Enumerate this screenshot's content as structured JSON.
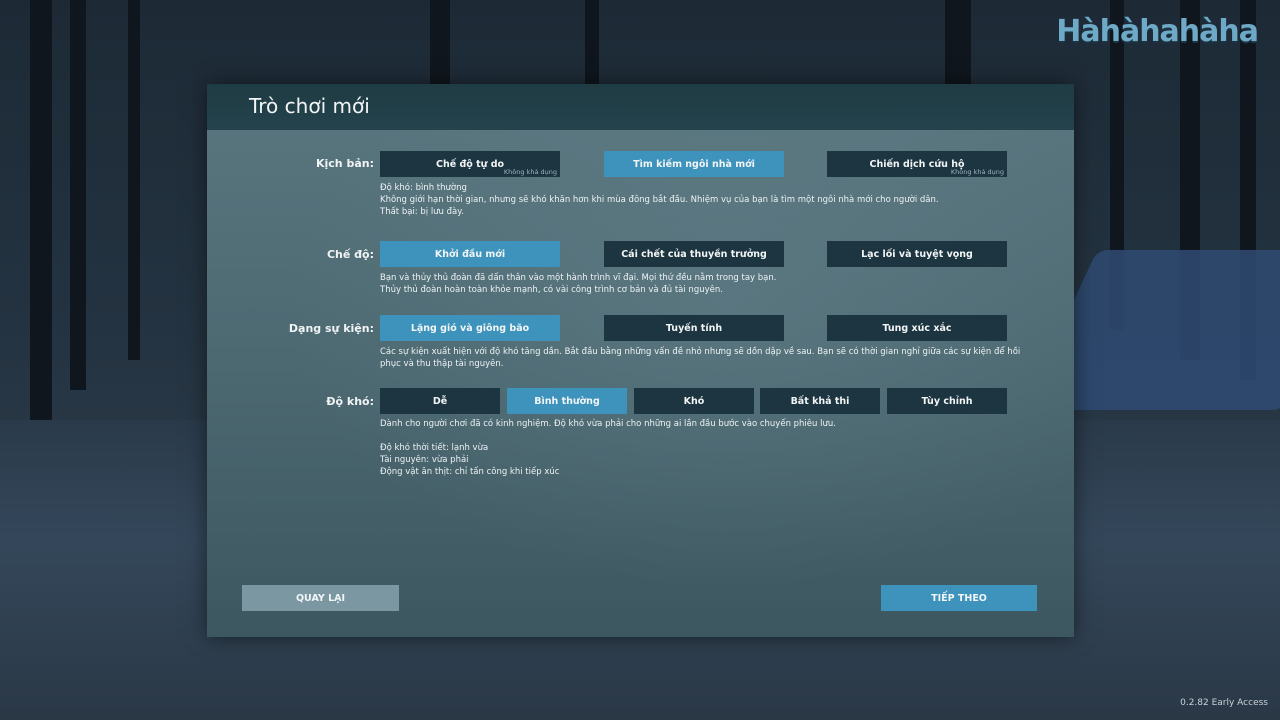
{
  "brand": {
    "logo": "Hàhàhahàha"
  },
  "version": "0.2.82 Early Access",
  "title": "Trò chơi mới",
  "sections": {
    "scenario": {
      "label": "Kịch bản:",
      "options": [
        {
          "label": "Chế độ tự do",
          "note": "Không khả dụng"
        },
        {
          "label": "Tìm kiếm ngôi nhà mới"
        },
        {
          "label": "Chiến dịch cứu hộ",
          "note": "Không khả dụng"
        }
      ],
      "desc": [
        "Độ khó: bình thường",
        "Không giới hạn thời gian, nhưng sẽ khó khăn hơn khi mùa đông bắt đầu. Nhiệm vụ của bạn là tìm một ngôi nhà mới cho người dân.",
        "Thất bại: bị lưu đày."
      ]
    },
    "mode": {
      "label": "Chế độ:",
      "options": [
        {
          "label": "Khởi đầu mới"
        },
        {
          "label": "Cái chết của thuyền trưởng"
        },
        {
          "label": "Lạc lối và tuyệt vọng"
        }
      ],
      "desc": [
        "Bạn và thủy thủ đoàn đã dấn thân vào một hành trình vĩ đại. Mọi thứ đều nằm trong tay bạn.",
        "Thủy thủ đoàn hoàn toàn khỏe mạnh, có vài công trình cơ bản và đủ tài nguyên."
      ]
    },
    "events": {
      "label": "Dạng sự kiện:",
      "options": [
        {
          "label": "Lặng gió và giông bão"
        },
        {
          "label": "Tuyến tính"
        },
        {
          "label": "Tung xúc xắc"
        }
      ],
      "desc": [
        "Các sự kiện xuất hiện với độ khó tăng dần. Bắt đầu bằng những vấn đề nhỏ nhưng sẽ dồn dập về sau. Bạn sẽ có thời gian nghỉ giữa các sự kiện để hồi",
        "phục và thu thập tài nguyên."
      ]
    },
    "difficulty": {
      "label": "Độ khó:",
      "options": [
        {
          "label": "Dễ"
        },
        {
          "label": "Bình thường"
        },
        {
          "label": "Khó"
        },
        {
          "label": "Bất khả thi"
        },
        {
          "label": "Tùy chỉnh"
        }
      ],
      "desc": [
        "Dành cho người chơi đã có kinh nghiệm. Độ khó vừa phải cho những ai lần đầu bước vào chuyến phiêu lưu.",
        "",
        "Độ khó thời tiết: lạnh vừa",
        "Tài nguyên: vừa phải",
        "Động vật ăn thịt: chỉ tấn công khi tiếp xúc"
      ]
    }
  },
  "nav": {
    "back": "QUAY LẠI",
    "next": "TIẾP THEO"
  }
}
